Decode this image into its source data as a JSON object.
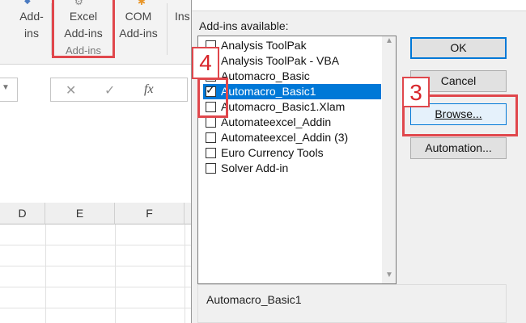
{
  "ribbon": {
    "addins_line1": "Add-",
    "addins_line2": "ins",
    "excel_addins_line1": "Excel",
    "excel_addins_line2": "Add-ins",
    "group_label": "Add-ins",
    "com_addins_line1": "COM",
    "com_addins_line2": "Add-ins",
    "insert_partial": "Ins"
  },
  "formula_bar": {
    "cancel_symbol": "✕",
    "enter_symbol": "✓",
    "fx_symbol": "fx"
  },
  "sheet": {
    "columns": [
      "D",
      "E",
      "F"
    ]
  },
  "dialog": {
    "title_partial": "",
    "available_label": "Add-ins available:",
    "items": [
      {
        "label": "Analysis ToolPak",
        "checked": false,
        "selected": false
      },
      {
        "label": "Analysis ToolPak - VBA",
        "checked": false,
        "selected": false
      },
      {
        "label": "Automacro_Basic",
        "checked": false,
        "selected": false
      },
      {
        "label": "Automacro_Basic1",
        "checked": true,
        "selected": true
      },
      {
        "label": "Automacro_Basic1.Xlam",
        "checked": false,
        "selected": false
      },
      {
        "label": "Automateexcel_Addin",
        "checked": false,
        "selected": false
      },
      {
        "label": "Automateexcel_Addin (3)",
        "checked": false,
        "selected": false
      },
      {
        "label": "Euro Currency Tools",
        "checked": false,
        "selected": false
      },
      {
        "label": "Solver Add-in",
        "checked": false,
        "selected": false
      }
    ],
    "ok_label": "OK",
    "cancel_label": "Cancel",
    "browse_label": "Browse...",
    "automation_label": "Automation...",
    "description_title": "Automacro_Basic1"
  },
  "annotations": {
    "step_3": "3",
    "step_4": "4",
    "highlight_color": "#e0474c"
  }
}
